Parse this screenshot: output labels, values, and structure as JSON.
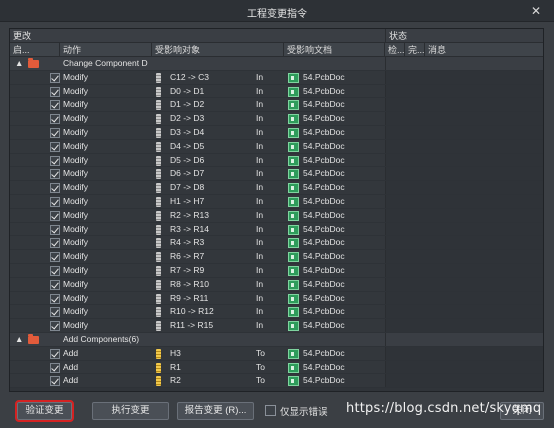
{
  "window": {
    "title": "工程变更指令",
    "close_glyph": "✕"
  },
  "table": {
    "group_headers": {
      "changes": "更改",
      "status": "状态"
    },
    "columns": [
      "启...",
      "动作",
      "受影响对象",
      "受影响文档",
      "检...",
      "完...",
      "消息"
    ],
    "rows": [
      {
        "type": "group",
        "label": "Change Component D"
      },
      {
        "type": "item",
        "action": "Modify",
        "icon": "component-gray",
        "object": "C12 -> C3",
        "dir": "In",
        "doc": "54.PcbDoc"
      },
      {
        "type": "item",
        "action": "Modify",
        "icon": "component-gray",
        "object": "D0 -> D1",
        "dir": "In",
        "doc": "54.PcbDoc"
      },
      {
        "type": "item",
        "action": "Modify",
        "icon": "component-gray",
        "object": "D1 -> D2",
        "dir": "In",
        "doc": "54.PcbDoc"
      },
      {
        "type": "item",
        "action": "Modify",
        "icon": "component-gray",
        "object": "D2 -> D3",
        "dir": "In",
        "doc": "54.PcbDoc"
      },
      {
        "type": "item",
        "action": "Modify",
        "icon": "component-gray",
        "object": "D3 -> D4",
        "dir": "In",
        "doc": "54.PcbDoc"
      },
      {
        "type": "item",
        "action": "Modify",
        "icon": "component-gray",
        "object": "D4 -> D5",
        "dir": "In",
        "doc": "54.PcbDoc"
      },
      {
        "type": "item",
        "action": "Modify",
        "icon": "component-gray",
        "object": "D5 -> D6",
        "dir": "In",
        "doc": "54.PcbDoc"
      },
      {
        "type": "item",
        "action": "Modify",
        "icon": "component-gray",
        "object": "D6 -> D7",
        "dir": "In",
        "doc": "54.PcbDoc"
      },
      {
        "type": "item",
        "action": "Modify",
        "icon": "component-gray",
        "object": "D7 -> D8",
        "dir": "In",
        "doc": "54.PcbDoc"
      },
      {
        "type": "item",
        "action": "Modify",
        "icon": "component-gray",
        "object": "H1 -> H7",
        "dir": "In",
        "doc": "54.PcbDoc"
      },
      {
        "type": "item",
        "action": "Modify",
        "icon": "component-gray",
        "object": "R2 -> R13",
        "dir": "In",
        "doc": "54.PcbDoc"
      },
      {
        "type": "item",
        "action": "Modify",
        "icon": "component-gray",
        "object": "R3 -> R14",
        "dir": "In",
        "doc": "54.PcbDoc"
      },
      {
        "type": "item",
        "action": "Modify",
        "icon": "component-gray",
        "object": "R4 -> R3",
        "dir": "In",
        "doc": "54.PcbDoc"
      },
      {
        "type": "item",
        "action": "Modify",
        "icon": "component-gray",
        "object": "R6 -> R7",
        "dir": "In",
        "doc": "54.PcbDoc"
      },
      {
        "type": "item",
        "action": "Modify",
        "icon": "component-gray",
        "object": "R7 -> R9",
        "dir": "In",
        "doc": "54.PcbDoc"
      },
      {
        "type": "item",
        "action": "Modify",
        "icon": "component-gray",
        "object": "R8 -> R10",
        "dir": "In",
        "doc": "54.PcbDoc"
      },
      {
        "type": "item",
        "action": "Modify",
        "icon": "component-gray",
        "object": "R9 -> R11",
        "dir": "In",
        "doc": "54.PcbDoc"
      },
      {
        "type": "item",
        "action": "Modify",
        "icon": "component-gray",
        "object": "R10 -> R12",
        "dir": "In",
        "doc": "54.PcbDoc"
      },
      {
        "type": "item",
        "action": "Modify",
        "icon": "component-gray",
        "object": "R11 -> R15",
        "dir": "In",
        "doc": "54.PcbDoc"
      },
      {
        "type": "group",
        "label": "Add Components(6)"
      },
      {
        "type": "item",
        "action": "Add",
        "icon": "component-yellow",
        "object": "H3",
        "dir": "To",
        "doc": "54.PcbDoc"
      },
      {
        "type": "item",
        "action": "Add",
        "icon": "component-yellow",
        "object": "R1",
        "dir": "To",
        "doc": "54.PcbDoc"
      },
      {
        "type": "item",
        "action": "Add",
        "icon": "component-yellow",
        "object": "R2",
        "dir": "To",
        "doc": "54.PcbDoc"
      }
    ]
  },
  "footer": {
    "validate_label": "验证变更",
    "execute_label": "执行变更",
    "report_label": "报告变更 (R)...",
    "only_errors_label": "仅显示错误",
    "watermark": "https://blog.csdn.net/skyqmq",
    "close_label": "关闭"
  },
  "colors": {
    "highlight_outline": "#d42222",
    "folder": "#e25b3b",
    "pcbdoc_icon": "#2e9c5b"
  }
}
